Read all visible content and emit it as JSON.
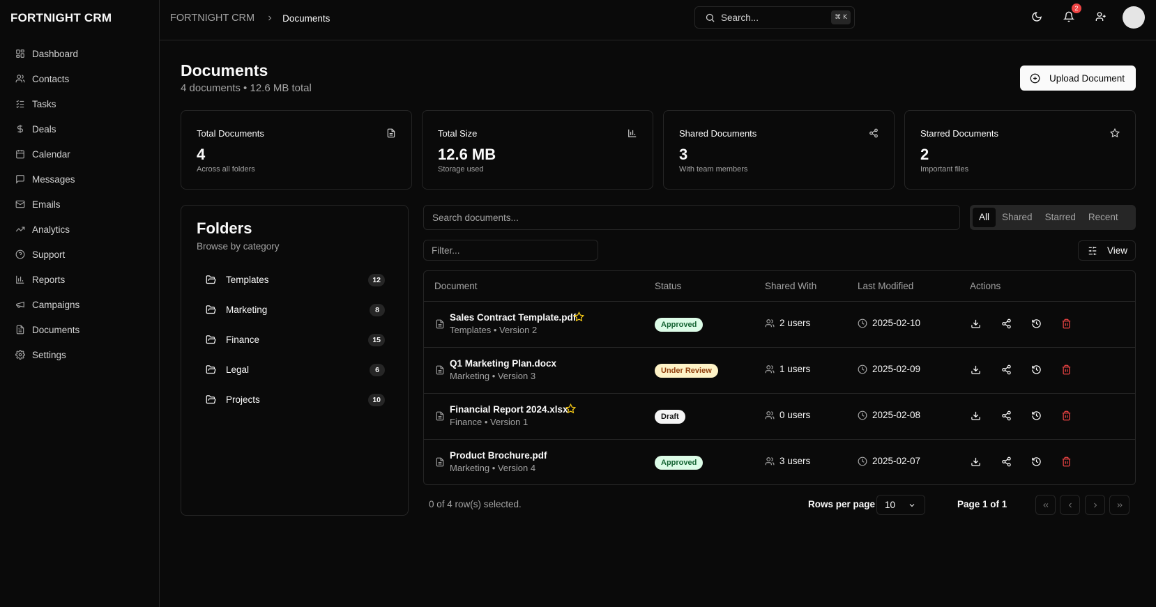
{
  "app": {
    "brand": "FORTNIGHT CRM"
  },
  "sidebar": {
    "items": [
      {
        "label": "Dashboard",
        "icon": "dashboard-icon"
      },
      {
        "label": "Contacts",
        "icon": "contacts-icon"
      },
      {
        "label": "Tasks",
        "icon": "tasks-icon"
      },
      {
        "label": "Deals",
        "icon": "dollar-icon"
      },
      {
        "label": "Calendar",
        "icon": "calendar-icon"
      },
      {
        "label": "Messages",
        "icon": "message-icon"
      },
      {
        "label": "Emails",
        "icon": "mail-icon"
      },
      {
        "label": "Analytics",
        "icon": "trend-icon"
      },
      {
        "label": "Support",
        "icon": "help-icon"
      },
      {
        "label": "Reports",
        "icon": "bar-chart-icon"
      },
      {
        "label": "Campaigns",
        "icon": "megaphone-icon"
      },
      {
        "label": "Documents",
        "icon": "document-icon"
      },
      {
        "label": "Settings",
        "icon": "gear-icon"
      }
    ]
  },
  "topbar": {
    "breadcrumb": [
      "FORTNIGHT CRM",
      "Documents"
    ],
    "search_label": "Search...",
    "search_shortcut": "⌘ K",
    "notification_count": "2"
  },
  "page": {
    "title": "Documents",
    "subtitle": "4 documents • 12.6 MB total",
    "upload_label": "Upload Document"
  },
  "stats": [
    {
      "label": "Total Documents",
      "value": "4",
      "desc": "Across all folders",
      "icon": "document-icon"
    },
    {
      "label": "Total Size",
      "value": "12.6 MB",
      "desc": "Storage used",
      "icon": "bar-chart-icon"
    },
    {
      "label": "Shared Documents",
      "value": "3",
      "desc": "With team members",
      "icon": "share-icon"
    },
    {
      "label": "Starred Documents",
      "value": "2",
      "desc": "Important files",
      "icon": "star-icon"
    }
  ],
  "folders": {
    "title": "Folders",
    "subtitle": "Browse by category",
    "items": [
      {
        "name": "Templates",
        "count": "12"
      },
      {
        "name": "Marketing",
        "count": "8"
      },
      {
        "name": "Finance",
        "count": "15"
      },
      {
        "name": "Legal",
        "count": "6"
      },
      {
        "name": "Projects",
        "count": "10"
      }
    ]
  },
  "docs": {
    "search_placeholder": "Search documents...",
    "tabs": [
      "All",
      "Shared",
      "Starred",
      "Recent"
    ],
    "active_tab": "All",
    "filter_placeholder": "Filter...",
    "view_label": "View",
    "columns": [
      "Document",
      "Status",
      "Shared With",
      "Last Modified",
      "Actions"
    ],
    "rows": [
      {
        "name": "Sales Contract Template.pdf",
        "meta": "Templates • Version 2",
        "starred": true,
        "status": "Approved",
        "shared": "2 users",
        "modified": "2025-02-10"
      },
      {
        "name": "Q1 Marketing Plan.docx",
        "meta": "Marketing • Version 3",
        "starred": false,
        "status": "Under Review",
        "shared": "1 users",
        "modified": "2025-02-09"
      },
      {
        "name": "Financial Report 2024.xlsx",
        "meta": "Finance • Version 1",
        "starred": true,
        "status": "Draft",
        "shared": "0 users",
        "modified": "2025-02-08"
      },
      {
        "name": "Product Brochure.pdf",
        "meta": "Marketing • Version 4",
        "starred": false,
        "status": "Approved",
        "shared": "3 users",
        "modified": "2025-02-07"
      }
    ]
  },
  "pagination": {
    "selection": "0 of 4 row(s) selected.",
    "rows_per_page_label": "Rows per page",
    "rows_per_page": "10",
    "page_info": "Page 1 of 1"
  },
  "colors": {
    "background": "#0a0a0a",
    "border": "#262626",
    "approved_bg": "#dcfce7",
    "approved_fg": "#166534",
    "review_bg": "#fef3c7",
    "review_fg": "#92400e",
    "draft_bg": "#f5f5f5",
    "draft_fg": "#171717",
    "danger": "#ef4444",
    "star": "#facc15"
  }
}
